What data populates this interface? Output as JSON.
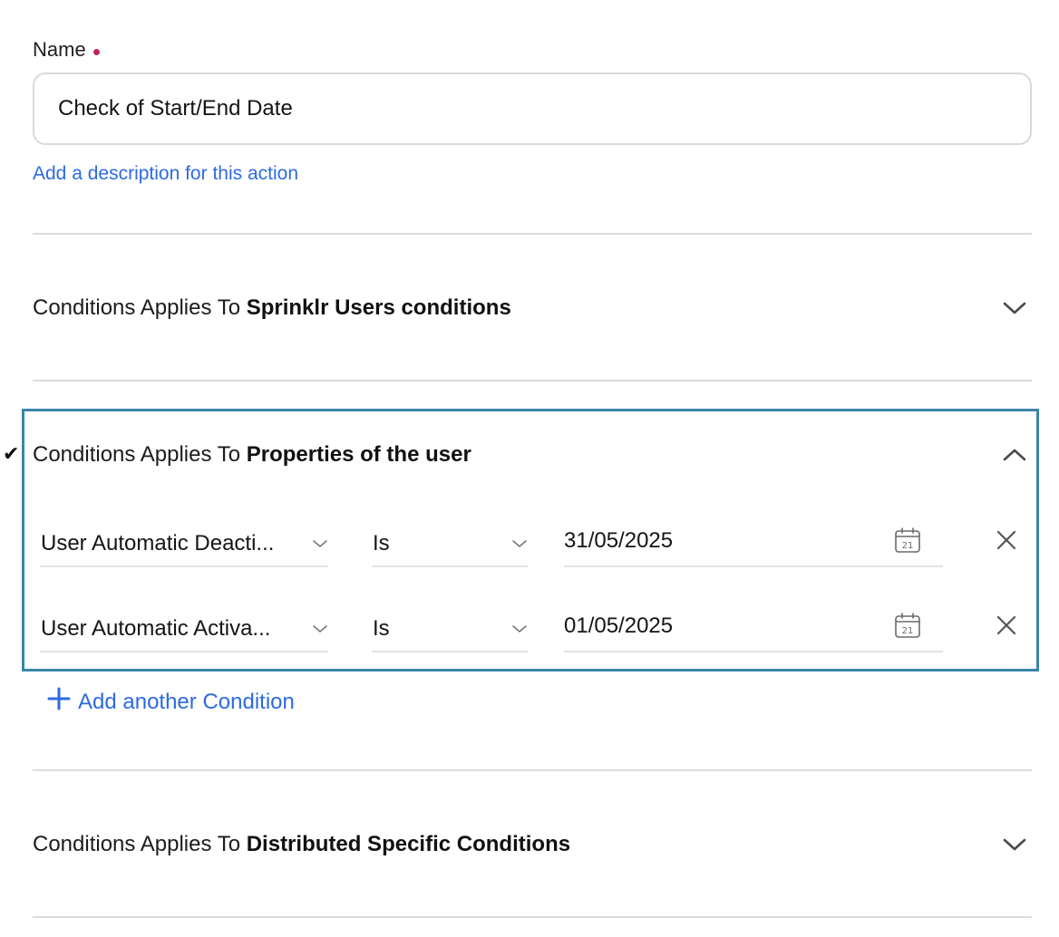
{
  "name_field": {
    "label": "Name",
    "value": "Check of Start/End Date",
    "required": true
  },
  "description_link": "Add a description for this action",
  "sections": [
    {
      "prefix": "Conditions Applies To",
      "title": "Sprinklr Users conditions",
      "expanded": false
    },
    {
      "prefix": "Conditions Applies To",
      "title": "Properties of the user",
      "expanded": true,
      "checked": true
    },
    {
      "prefix": "Conditions Applies To",
      "title": "Distributed Specific Conditions",
      "expanded": false
    }
  ],
  "conditions": [
    {
      "field": "User Automatic Deacti...",
      "operator": "Is",
      "value": "31/05/2025",
      "calendar_day": "21"
    },
    {
      "field": "User Automatic Activa...",
      "operator": "Is",
      "value": "01/05/2025",
      "calendar_day": "21"
    }
  ],
  "add_condition_label": "Add another Condition",
  "checkmark": "✔",
  "colors": {
    "accent_link": "#2d6be0",
    "required_dot": "#c0245c",
    "expanded_border": "#3b86a8"
  }
}
